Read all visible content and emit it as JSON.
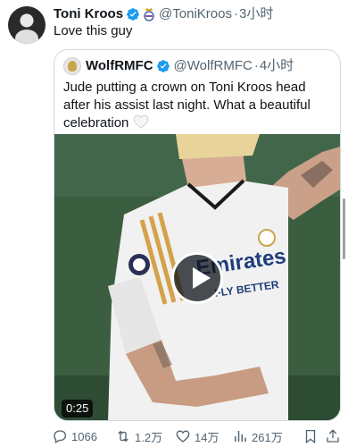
{
  "tweet": {
    "author_name": "Toni Kroos",
    "author_handle": "@ToniKroos",
    "time": "3小时",
    "separator": "·",
    "text": "Love this guy"
  },
  "quote": {
    "author_name": "WolfRMFC",
    "author_handle": "@WolfRMFC",
    "time": "4小时",
    "separator": "·",
    "text": "Jude putting a crown on Toni Kroos head after his assist last night. What a beautiful celebration",
    "video_duration": "0:25",
    "jersey_text": [
      "Emirates",
      "FLY BETTER"
    ]
  },
  "actions": {
    "replies": "1066",
    "retweets": "1.2万",
    "likes": "14万",
    "views": "261万"
  },
  "colors": {
    "verified": "#1d9bf0",
    "text": "#0f1419",
    "secondary": "#536471",
    "border": "#cfd9de"
  }
}
